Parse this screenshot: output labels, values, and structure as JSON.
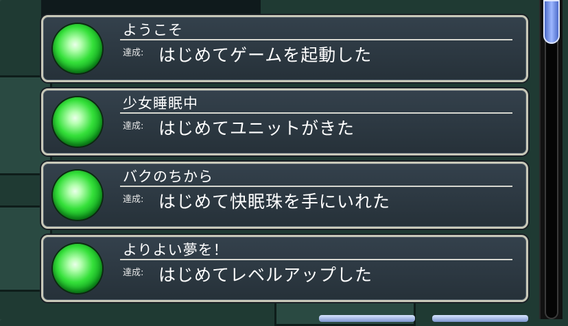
{
  "achievements": [
    {
      "title": "ようこそ",
      "tag": "達成:",
      "description": "はじめてゲームを起動した"
    },
    {
      "title": "少女睡眠中",
      "tag": "達成:",
      "description": "はじめてユニットがきた"
    },
    {
      "title": "バクのちから",
      "tag": "達成:",
      "description": "はじめて快眠珠を手にいれた"
    },
    {
      "title": "よりよい夢を！",
      "tag": "達成:",
      "description": "はじめてレベルアップした"
    }
  ],
  "colors": {
    "panel": "#2c3942",
    "panel_border": "#c9c9b9",
    "orb": "#35e03a",
    "scroll_thumb": "#7f9cf0"
  }
}
